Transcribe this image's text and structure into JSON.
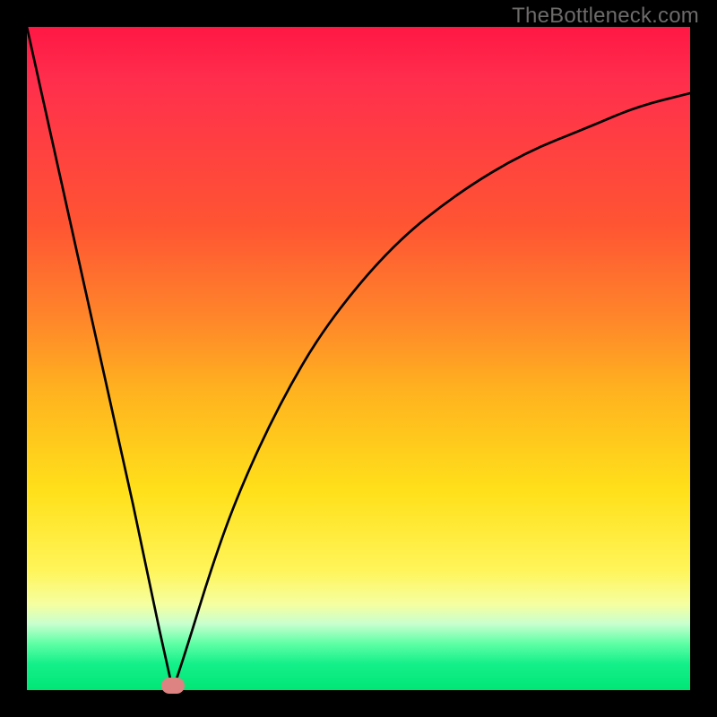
{
  "watermark": "TheBottleneck.com",
  "colors": {
    "gradient_top": "#ff1744",
    "gradient_upper_mid": "#ff8a29",
    "gradient_lower_mid": "#ffe01a",
    "gradient_bottom": "#00e676",
    "curve_stroke": "#000000",
    "frame_border": "#000000",
    "dot_fill": "#dd8381"
  },
  "chart_data": {
    "type": "line",
    "title": "",
    "xlabel": "",
    "ylabel": "",
    "xlim": [
      0,
      100
    ],
    "ylim": [
      0,
      100
    ],
    "legend": [],
    "annotations": [],
    "grid": false,
    "curve_description": "V-shaped bottleneck curve: steep linear descent from top-left to a minimum near x≈22 at y≈0, then a concave-down rise (with diminishing slope) toward the upper right, ending near y≈90 at x=100.",
    "series": [
      {
        "name": "bottleneck-curve",
        "x": [
          0,
          4,
          8,
          12,
          16,
          20,
          22,
          24,
          28,
          32,
          38,
          45,
          55,
          65,
          75,
          85,
          92,
          100
        ],
        "values": [
          100,
          82,
          64,
          46,
          28,
          9,
          0,
          6,
          19,
          30,
          43,
          55,
          67,
          75,
          81,
          85,
          88,
          90
        ]
      }
    ],
    "marker": {
      "x": 22,
      "y": 0,
      "shape": "rounded-pill",
      "color": "#dd8381"
    }
  }
}
